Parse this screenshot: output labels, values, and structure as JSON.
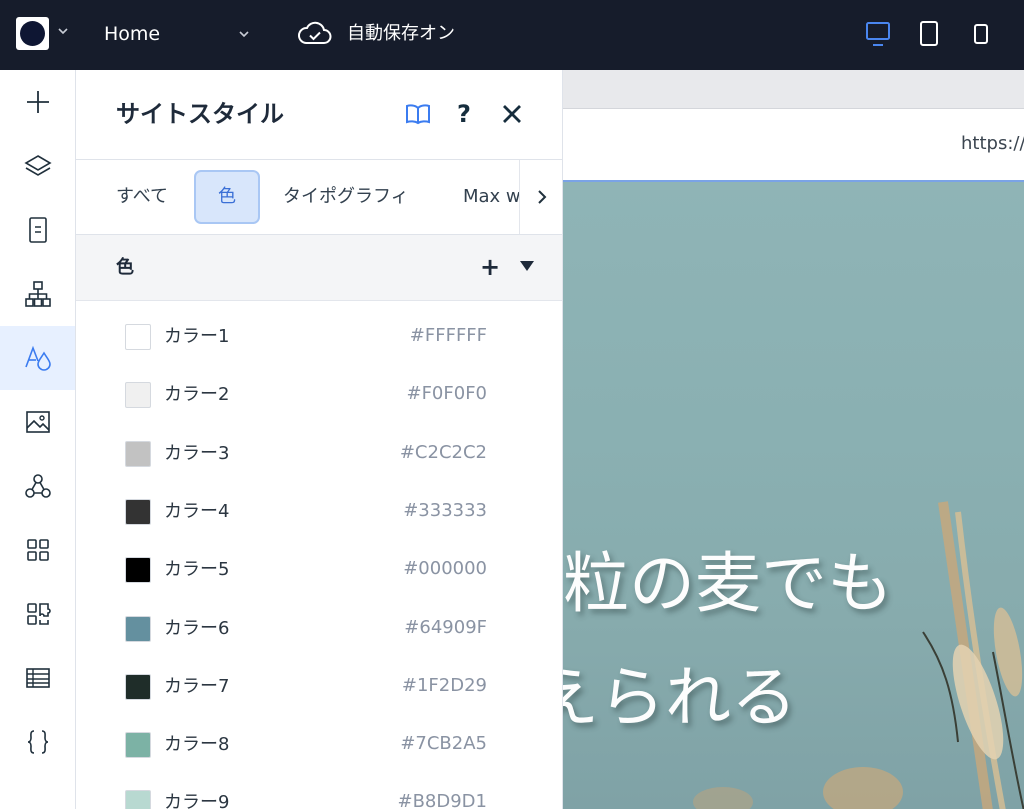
{
  "topbar": {
    "page_name": "Home",
    "autosave_label": "自動保存オン"
  },
  "panel": {
    "title": "サイトスタイル",
    "help_label": "?",
    "tabs": [
      {
        "label": "すべて"
      },
      {
        "label": "色"
      },
      {
        "label": "タイポグラフィ"
      },
      {
        "label": "Max w"
      }
    ],
    "active_tab": "色",
    "section_title": "色",
    "section_add": "+",
    "colors": [
      {
        "name": "カラー1",
        "hex": "#FFFFFF"
      },
      {
        "name": "カラー2",
        "hex": "#F0F0F0"
      },
      {
        "name": "カラー3",
        "hex": "#C2C2C2"
      },
      {
        "name": "カラー4",
        "hex": "#333333"
      },
      {
        "name": "カラー5",
        "hex": "#000000"
      },
      {
        "name": "カラー6",
        "hex": "#64909F"
      },
      {
        "name": "カラー7",
        "hex": "#1F2D29"
      },
      {
        "name": "カラー8",
        "hex": "#7CB2A5"
      },
      {
        "name": "カラー9",
        "hex": "#B8D9D1"
      }
    ]
  },
  "canvas": {
    "url": "https://",
    "hero_line_1": "粒の麦でも",
    "hero_line_2": "えられる"
  },
  "rail": {
    "items": [
      {
        "icon": "add-icon"
      },
      {
        "icon": "layers-icon"
      },
      {
        "icon": "page-icon"
      },
      {
        "icon": "sitemap-icon"
      },
      {
        "icon": "site-style-icon",
        "active": true
      },
      {
        "icon": "media-icon"
      },
      {
        "icon": "connections-icon"
      },
      {
        "icon": "apps-icon"
      },
      {
        "icon": "business-icon"
      },
      {
        "icon": "cms-table-icon"
      },
      {
        "icon": "code-icon"
      }
    ]
  },
  "colors_ui": {
    "accent": "#3B7CF0",
    "topbar_bg": "#161C2B",
    "active_bg": "#E7F0FF"
  }
}
